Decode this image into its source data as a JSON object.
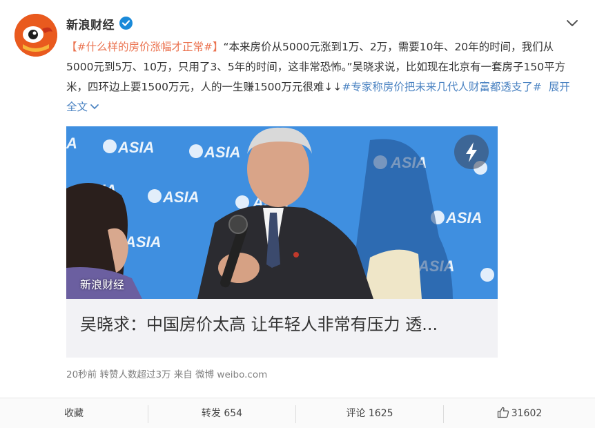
{
  "post": {
    "username": "新浪财经",
    "icons": {
      "avatar": "sina-eye-avatar",
      "verified": "verified-badge-icon",
      "more": "chevron-down-icon"
    },
    "text": {
      "open_bracket": "【",
      "topic_tag": "#什么样的房价涨幅才正常#",
      "close_bracket": "】",
      "body": "“本来房价从5000元涨到1万、2万，需要10年、20年的时间，我们从5000元到5万、10万，只用了3、5年的时间，这非常恐怖。”吴晓求说，比如现在北京有一套房子150平方米，四环边上要1500万元，人的一生赚1500万元很难↓↓",
      "hashtag": "#专家称房价把未来几代人财富都透支了#",
      "expand_label": "展开全文",
      "expand_icon": "chevron-down-icon"
    },
    "media": {
      "watermark": "新浪财经",
      "backdrop_text": "ASIA",
      "flash_icon": "lightning-icon",
      "caption": "吴晓求：中国房价太高 让年轻人非常有压力 透..."
    },
    "meta": "20秒前 转赞人数超过3万 来自 微博 weibo.com"
  },
  "footer": {
    "favorite_label": "收藏",
    "repost_label": "转发 654",
    "comment_label": "评论 1625",
    "like_count": "31602",
    "like_icon": "thumbs-up-icon"
  },
  "colors": {
    "link_blue": "#4b83c2",
    "tag_orange": "#eb7350",
    "verified_blue": "#1a8ad9",
    "backdrop_blue": "#3f8fe0"
  }
}
